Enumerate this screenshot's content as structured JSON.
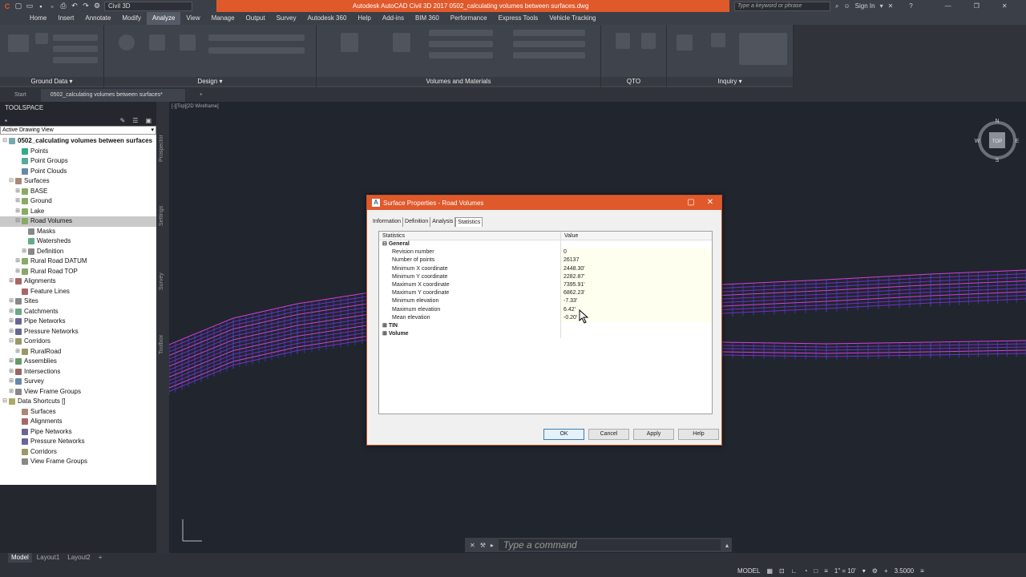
{
  "app": {
    "workspace": "Civil 3D",
    "title": "Autodesk AutoCAD Civil 3D 2017    0502_calculating volumes between surfaces.dwg",
    "search_placeholder": "Type a keyword or phrase",
    "sign_in": "Sign In"
  },
  "menu_tabs": [
    "Home",
    "Insert",
    "Annotate",
    "Modify",
    "Analyze",
    "View",
    "Manage",
    "Output",
    "Survey",
    "Autodesk 360",
    "Help",
    "Add-ins",
    "BIM 360",
    "Performance",
    "Express Tools",
    "Vehicle Tracking"
  ],
  "active_menu_tab": "Analyze",
  "ribbon_panels": {
    "ground_data": "Ground Data",
    "design": "Design",
    "volumes": "Volumes and Materials",
    "qto": "QTO",
    "inquiry": "Inquiry"
  },
  "doc_tabs": {
    "start": "Start",
    "active": "0502_calculating volumes between surfaces*",
    "add": "+"
  },
  "toolspace": {
    "title": "TOOLSPACE",
    "view_combo": "Active Drawing View",
    "side_tabs": [
      "Prospector",
      "Settings",
      "Survey",
      "Toolbox"
    ],
    "root": "0502_calculating volumes between surfaces",
    "items": {
      "points": "Points",
      "point_groups": "Point Groups",
      "point_clouds": "Point Clouds",
      "surfaces": "Surfaces",
      "base": "BASE",
      "ground": "Ground",
      "lake": "Lake",
      "road_volumes": "Road Volumes",
      "masks": "Masks",
      "watersheds": "Watersheds",
      "definition": "Definition",
      "rural_datum": "Rural Road DATUM",
      "rural_top": "Rural Road TOP",
      "alignments": "Alignments",
      "feature_lines": "Feature Lines",
      "sites": "Sites",
      "catchments": "Catchments",
      "pipe_networks": "Pipe Networks",
      "pressure_networks": "Pressure Networks",
      "corridors": "Corridors",
      "rural_road": "RuralRoad",
      "assemblies": "Assemblies",
      "intersections": "Intersections",
      "survey": "Survey",
      "view_frame_groups": "View Frame Groups",
      "data_shortcuts": "Data Shortcuts []",
      "ds_surfaces": "Surfaces",
      "ds_alignments": "Alignments",
      "ds_pipe_networks": "Pipe Networks",
      "ds_pressure_networks": "Pressure Networks",
      "ds_corridors": "Corridors",
      "ds_view_frame_groups": "View Frame Groups"
    }
  },
  "viewport": {
    "label": "[-][Top][2D Wireframe]",
    "compass": {
      "n": "N",
      "s": "S",
      "e": "E",
      "w": "W",
      "top": "TOP"
    }
  },
  "dialog": {
    "title": "Surface Properties - Road Volumes",
    "tabs": [
      "Information",
      "Definition",
      "Analysis",
      "Statistics"
    ],
    "active_tab": "Statistics",
    "col_statistics": "Statistics",
    "col_value": "Value",
    "general": "General",
    "rows": [
      {
        "name": "Revision number",
        "value": "0"
      },
      {
        "name": "Number of points",
        "value": "26137"
      },
      {
        "name": "Minimum X coordinate",
        "value": "2448.30'"
      },
      {
        "name": "Minimum Y coordinate",
        "value": "2282.87'"
      },
      {
        "name": "Maximum X coordinate",
        "value": "7395.91'"
      },
      {
        "name": "Maximum Y coordinate",
        "value": "6862.23'"
      },
      {
        "name": "Minimum elevation",
        "value": "-7.33'"
      },
      {
        "name": "Maximum elevation",
        "value": "6.42'"
      },
      {
        "name": "Mean elevation",
        "value": "-0.20'"
      }
    ],
    "tin": "TIN",
    "volume": "Volume",
    "buttons": {
      "ok": "OK",
      "cancel": "Cancel",
      "apply": "Apply",
      "help": "Help"
    }
  },
  "command_line": {
    "placeholder": "Type a command"
  },
  "layout_tabs": [
    "Model",
    "Layout1",
    "Layout2"
  ],
  "status": {
    "model": "MODEL",
    "scale": "1\" = 10'",
    "value": "3.5000"
  }
}
